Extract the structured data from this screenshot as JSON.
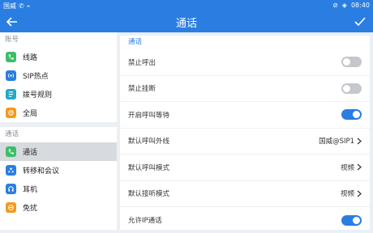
{
  "status": {
    "carrier": "国威",
    "time": "08:40"
  },
  "appbar": {
    "title": "通话"
  },
  "sidebar": {
    "sections": [
      {
        "title": "账号",
        "items": [
          {
            "label": "线路",
            "color": "#3bbf66"
          },
          {
            "label": "SIP热点",
            "color": "#2a7ee2"
          },
          {
            "label": "拨号规则",
            "color": "#20a8c8"
          },
          {
            "label": "全局",
            "color": "#f39a1f"
          }
        ]
      },
      {
        "title": "通话",
        "items": [
          {
            "label": "通话",
            "color": "#3bbf66"
          },
          {
            "label": "转移和会议",
            "color": "#2a7ee2"
          },
          {
            "label": "耳机",
            "color": "#2a7ee2"
          },
          {
            "label": "免扰",
            "color": "#f39a1f"
          }
        ]
      }
    ]
  },
  "main": {
    "heading": "通话",
    "rows": [
      {
        "label": "禁止呼出",
        "type": "toggle",
        "on": false
      },
      {
        "label": "禁止挂断",
        "type": "toggle",
        "on": false
      },
      {
        "label": "开启呼叫等待",
        "type": "toggle",
        "on": true
      },
      {
        "label": "默认呼叫外线",
        "type": "value",
        "value": "国威@SIP1"
      },
      {
        "label": "默认呼叫模式",
        "type": "value",
        "value": "视频"
      },
      {
        "label": "默认接听模式",
        "type": "value",
        "value": "视频"
      },
      {
        "label": "允许IP通话",
        "type": "toggle",
        "on": true
      }
    ]
  }
}
